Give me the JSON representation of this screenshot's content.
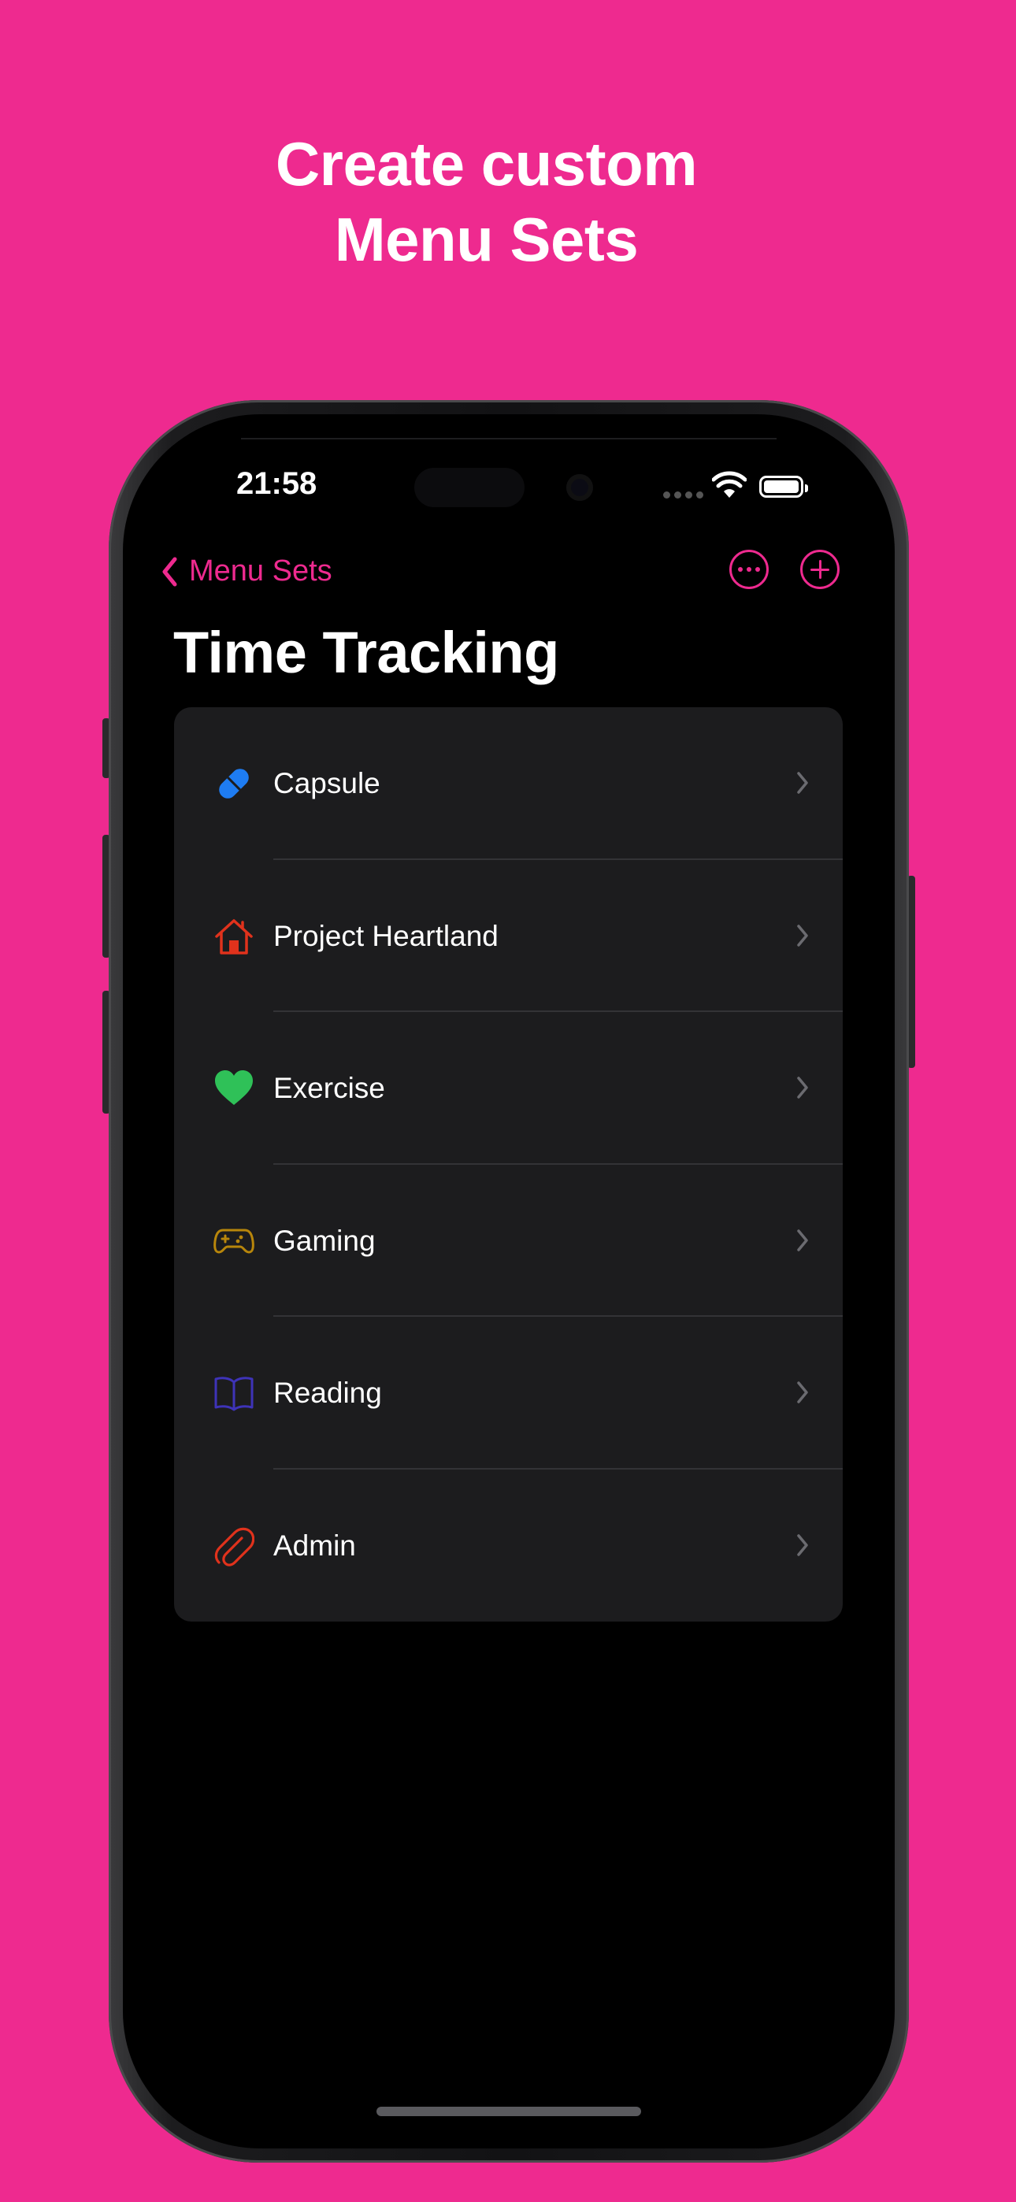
{
  "headline": {
    "line1": "Create custom",
    "line2": "Menu Sets"
  },
  "status_bar": {
    "time": "21:58"
  },
  "nav": {
    "back_label": "Menu Sets"
  },
  "page": {
    "title": "Time Tracking"
  },
  "colors": {
    "accent": "#EE2A8F",
    "background": "#EE2A8F",
    "list_bg": "#1C1C1E"
  },
  "items": [
    {
      "label": "Capsule",
      "icon": "pill-icon",
      "color": "#1E7CF2"
    },
    {
      "label": "Project Heartland",
      "icon": "house-icon",
      "color": "#E0321C"
    },
    {
      "label": "Exercise",
      "icon": "heart-icon",
      "color": "#2FC158"
    },
    {
      "label": "Gaming",
      "icon": "gamecontroller-icon",
      "color": "#B8860B"
    },
    {
      "label": "Reading",
      "icon": "book-icon",
      "color": "#3E33B8"
    },
    {
      "label": "Admin",
      "icon": "paperclip-icon",
      "color": "#E0321C"
    }
  ]
}
